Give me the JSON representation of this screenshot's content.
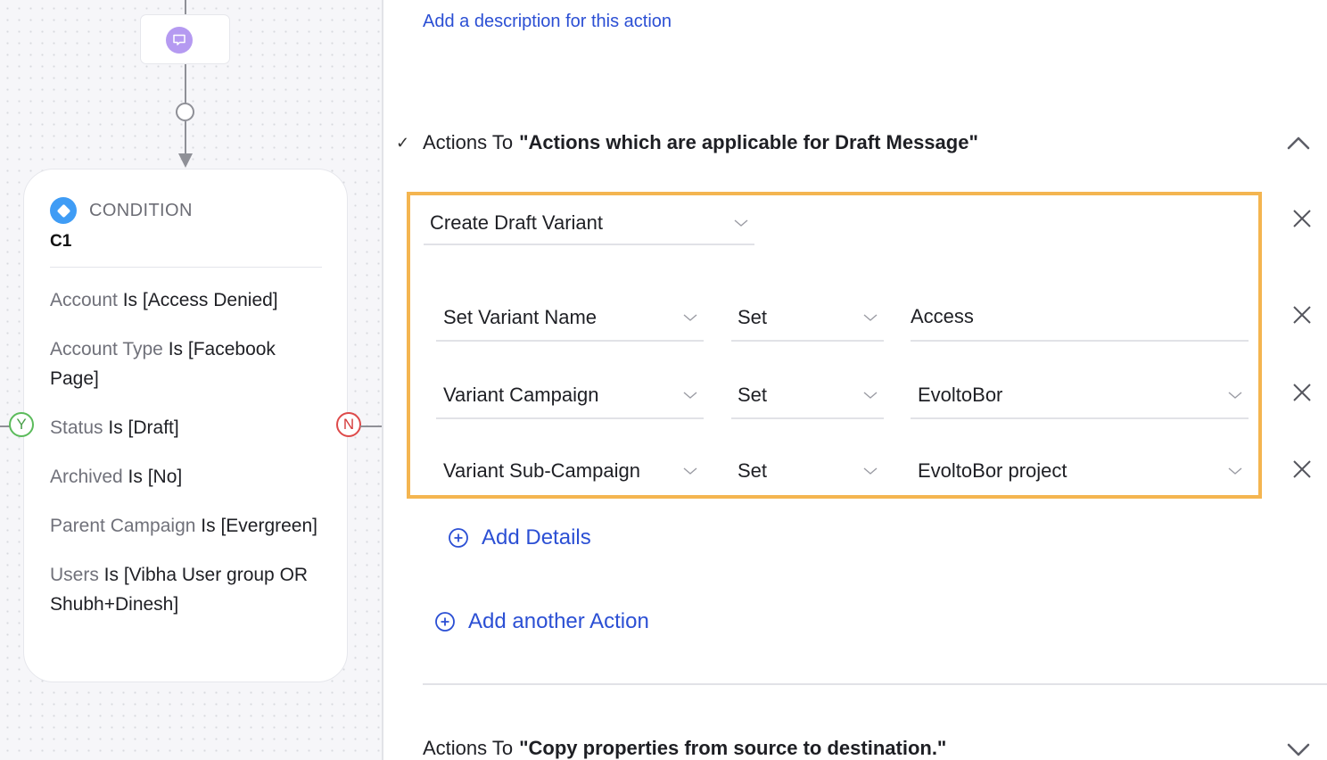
{
  "canvas": {
    "message_node": {
      "icon": "chat-bubble-icon",
      "color": "#b59af1"
    },
    "condition_node": {
      "icon": "condition-diamond-icon",
      "icon_color": "#3f9cf5",
      "type_label": "CONDITION",
      "id": "C1",
      "conditions": [
        {
          "field": "Account",
          "rest": " Is [Access Denied]"
        },
        {
          "field": "Account Type",
          "rest": " Is [Facebook Page]"
        },
        {
          "field": "Status",
          "rest": " Is [Draft]"
        },
        {
          "field": "Archived",
          "rest": " Is [No]"
        },
        {
          "field": "Parent Campaign",
          "rest": " Is [Evergreen]"
        },
        {
          "field": "Users",
          "rest": " Is [Vibha User group OR Shubh+Dinesh]"
        }
      ],
      "yes_label": "Y",
      "no_label": "N"
    }
  },
  "panel": {
    "add_description_link": "Add a description for this action",
    "section1": {
      "prefix": "Actions To",
      "title": "\"Actions which are applicable for Draft Message\"",
      "expanded": true
    },
    "action": {
      "type": "Create Draft Variant",
      "details": [
        {
          "field": "Set Variant Name",
          "operator": "Set",
          "value": "Access",
          "value_kind": "input"
        },
        {
          "field": "Variant Campaign",
          "operator": "Set",
          "value": "EvoltoBor",
          "value_kind": "select"
        },
        {
          "field": "Variant Sub-Campaign",
          "operator": "Set",
          "value": "EvoltoBor project",
          "value_kind": "select"
        }
      ]
    },
    "add_details_label": "Add Details",
    "add_another_action_label": "Add another Action",
    "section2": {
      "prefix": "Actions To",
      "title": "\"Copy properties from source to destination.\"",
      "expanded": false
    },
    "highlight_color": "#f4b550",
    "link_color": "#2b4fd4"
  }
}
